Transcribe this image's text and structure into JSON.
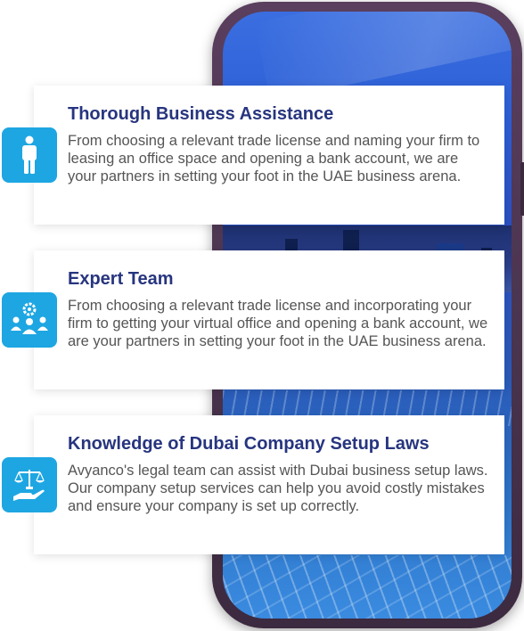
{
  "colors": {
    "title": "#27357f",
    "body_text": "#555555",
    "icon_bg": "#1ea6e2",
    "phone_frame": "#4a3550"
  },
  "features": [
    {
      "icon": "person-icon",
      "title": "Thorough Business Assistance",
      "description": "From choosing a relevant trade license and naming your firm to leasing an office space and opening a bank account, we are your partners in setting your foot in the UAE business arena."
    },
    {
      "icon": "team-gear-icon",
      "title": "Expert Team",
      "description": "From choosing a relevant trade license and incorporating your firm to getting your virtual office and opening a bank account, we are your partners in setting your foot in the UAE business arena."
    },
    {
      "icon": "scales-hand-icon",
      "title": "Knowledge of Dubai Company Setup Laws",
      "description": "Avyanco's legal team can assist with Dubai business setup laws. Our company setup services can help you avoid costly mistakes and ensure your company is set up correctly."
    }
  ]
}
